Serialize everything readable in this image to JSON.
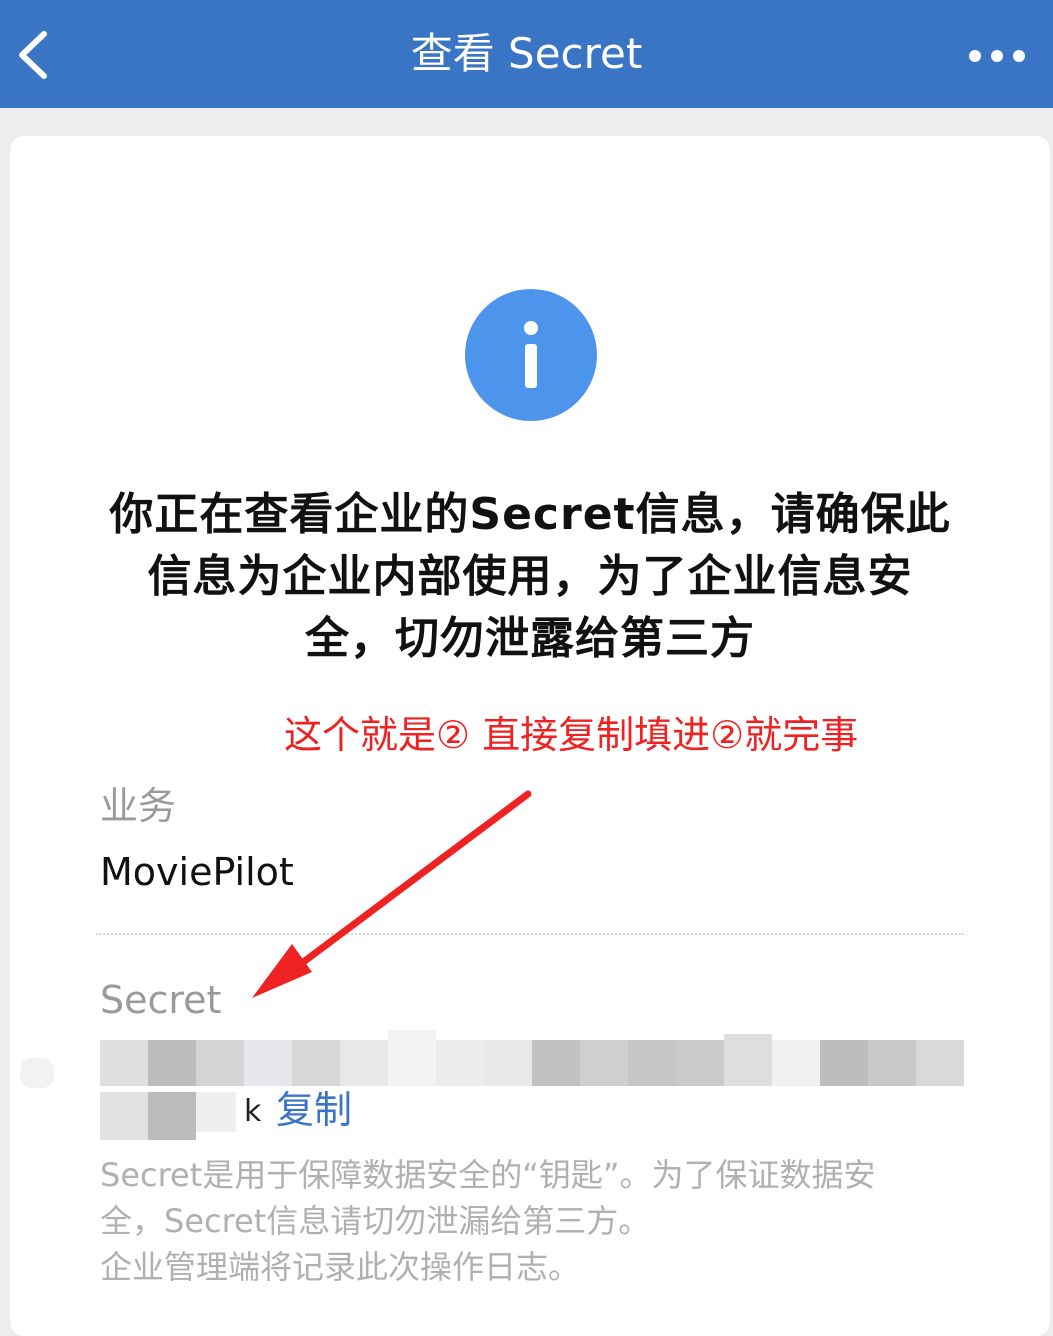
{
  "navbar": {
    "title": "查看 Secret",
    "background_color": "#3a74c5",
    "back_icon": "chevron-left-icon",
    "more_icon": "more-dots-icon"
  },
  "info": {
    "icon": "info-icon",
    "icon_color": "#4d95ec",
    "headline_lines": [
      "你正在查看企业的Secret信息，请确保此",
      "信息为企业内部使用，为了企业信息安",
      "全，切勿泄露给第三方"
    ]
  },
  "annotation": {
    "text": "这个就是② 直接复制填进②就完事",
    "color": "#ee2222"
  },
  "business": {
    "label": "业务",
    "value": "MoviePilot"
  },
  "secret": {
    "label": "Secret",
    "visible_tail": "k",
    "copy_label": "复制",
    "link_color": "#3b73c7"
  },
  "help": {
    "lines": [
      "Secret是用于保障数据安全的“钥匙”。为了保证数据安",
      "全，Secret信息请切勿泄漏给第三方。",
      "企业管理端将记录此次操作日志。"
    ]
  }
}
